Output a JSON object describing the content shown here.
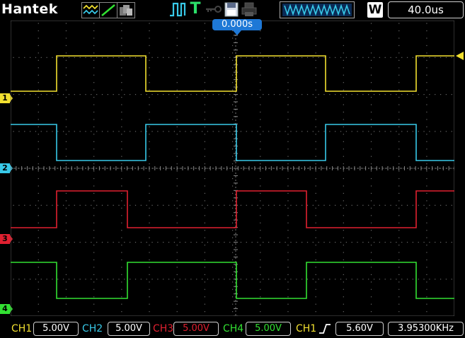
{
  "toolbar": {
    "brand": "Hantek",
    "timebase": "40.0us",
    "acq_badge": "W"
  },
  "trigger_marker": {
    "position_text": "0.000s"
  },
  "channels": [
    {
      "id": "1",
      "label": "CH1",
      "volts_div": "5.00V",
      "color": "#f2e030"
    },
    {
      "id": "2",
      "label": "CH2",
      "volts_div": "5.00V",
      "color": "#38c9e8"
    },
    {
      "id": "3",
      "label": "CH3",
      "volts_div": "5.00V",
      "color": "#e02030"
    },
    {
      "id": "4",
      "label": "CH4",
      "volts_div": "5.00V",
      "color": "#32e032"
    }
  ],
  "trigger": {
    "source": "CH1",
    "edge": "rising",
    "level": "5.60V",
    "frequency": "3.95300KHz"
  },
  "icons": {
    "mode": "waveform-mode-icon",
    "slope": "slope-icon",
    "persistence": "persistence-icon",
    "pulse": "pulse-icon",
    "trigger_status": "T",
    "key": "key-icon",
    "save": "save-icon",
    "print": "print-icon"
  }
}
